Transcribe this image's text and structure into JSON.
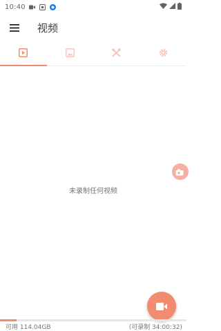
{
  "status_bar": {
    "time": "10:40",
    "icons": [
      "video-notification-icon",
      "shield-notification-icon",
      "app-notification-icon",
      "wifi-icon",
      "signal-icon",
      "battery-icon"
    ]
  },
  "app_bar": {
    "title": "视频",
    "menu_icon": "menu-icon"
  },
  "tabs": [
    {
      "name": "videos",
      "icon": "play-icon",
      "active": true
    },
    {
      "name": "images",
      "icon": "image-icon",
      "active": false
    },
    {
      "name": "tools",
      "icon": "tools-icon",
      "active": false
    },
    {
      "name": "settings",
      "icon": "gear-icon",
      "active": false
    }
  ],
  "empty_state": {
    "text": "未录制任何视频"
  },
  "storage": {
    "available": "可用 114.04GB",
    "recordable": "(可录制 34:00:32)",
    "used_fraction": 0.09
  },
  "colors": {
    "accent": "#f28b70",
    "accent_light": "#f6b0a1",
    "inactive_icon": "#f9c5b7"
  }
}
